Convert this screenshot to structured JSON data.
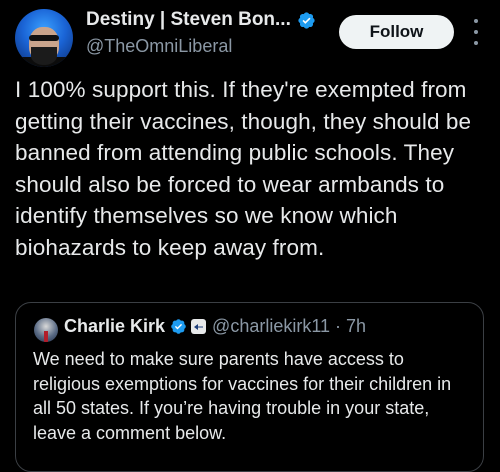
{
  "author": {
    "display_name": "Destiny | Steven Bon...",
    "handle": "@TheOmniLiberal",
    "verified_color": "#1d9bf0",
    "avatar_icon": "profile-photo"
  },
  "actions": {
    "follow_label": "Follow",
    "more_icon": "more-vertical-icon"
  },
  "tweet": {
    "text": "I 100% support this. If they're exempted from getting their vaccines, though, they should be banned from attending public schools. They should also be forced to wear armbands to identify themselves so we know which biohazards to keep away from."
  },
  "quoted_tweet": {
    "display_name": "Charlie Kirk",
    "handle_time": "@charliekirk11 · 7h",
    "text": "We need to make sure parents have access to religious exemptions for vaccines for their children in all 50 states. If you’re having trouble in your state, leave a comment below.",
    "verified_color": "#1d9bf0"
  },
  "colors": {
    "background": "#000000",
    "primary_text": "#e7e9ea",
    "secondary_text": "#8b98a5",
    "follow_bg": "#eff3f4",
    "border": "#3b3f44"
  }
}
